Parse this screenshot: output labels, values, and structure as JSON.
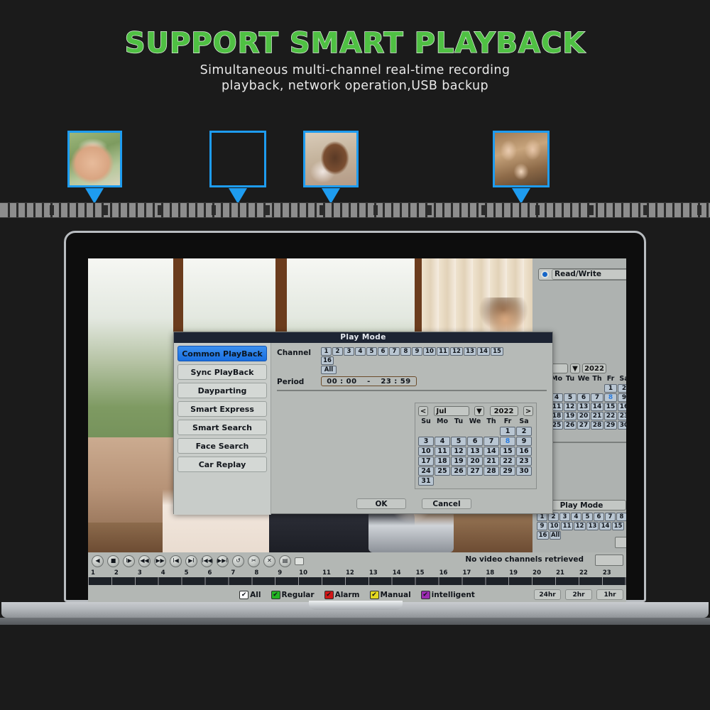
{
  "header": {
    "title": "SUPPORT SMART PLAYBACK",
    "subtitle_line1": "Simultaneous multi-channel real-time recording",
    "subtitle_line2": "playback, network operation,USB backup",
    "title_color": "#4fc043",
    "thumb_border_color": "#1e9cf0"
  },
  "thumbnails": [
    {
      "name": "thumb-elderly-man"
    },
    {
      "name": "thumb-child-balloon"
    },
    {
      "name": "thumb-girl-profile"
    },
    {
      "name": "thumb-family-group"
    }
  ],
  "dialog": {
    "title": "Play Mode",
    "modes": [
      "Common PlayBack",
      "Sync PlayBack",
      "Dayparting",
      "Smart Express",
      "Smart Search",
      "Face Search",
      "Car Replay"
    ],
    "active_mode": "Common PlayBack",
    "channel_label": "Channel",
    "channels": [
      "1",
      "2",
      "3",
      "4",
      "5",
      "6",
      "7",
      "8",
      "9",
      "10",
      "11",
      "12",
      "13",
      "14",
      "15",
      "16"
    ],
    "channel_all": "All",
    "selected_channels": [
      "2",
      "14"
    ],
    "period_label": "Period",
    "period_start": "00 : 00",
    "period_dash": "-",
    "period_end": "23 : 59",
    "ok_label": "OK",
    "cancel_label": "Cancel"
  },
  "calendar": {
    "prev_label": "<",
    "next_label": ">",
    "month": "Jul",
    "year": "2022",
    "dropdown_icon": "chevron-down-icon",
    "dow": [
      "Su",
      "Mo",
      "Tu",
      "We",
      "Th",
      "Fr",
      "Sa"
    ],
    "lead_blanks": 5,
    "days": [
      1,
      2,
      3,
      4,
      5,
      6,
      7,
      8,
      9,
      10,
      11,
      12,
      13,
      14,
      15,
      16,
      17,
      18,
      19,
      20,
      21,
      22,
      23,
      24,
      25,
      26,
      27,
      28,
      29,
      30,
      31
    ],
    "selected_day": 8
  },
  "right_panel": {
    "readwrite_label": "Read/Write",
    "radio_icon": "radio-selected-icon",
    "play_mode_title": "Play Mode",
    "channels": [
      "1",
      "2",
      "3",
      "4",
      "5",
      "6",
      "7",
      "8",
      "9",
      "10",
      "11",
      "12",
      "13",
      "14",
      "15",
      "16"
    ],
    "channel_all": "All"
  },
  "controls": {
    "buttons": [
      {
        "name": "play-reverse-button",
        "glyph": "◀"
      },
      {
        "name": "stop-button",
        "glyph": "■"
      },
      {
        "name": "slow-forward-button",
        "glyph": "I▶"
      },
      {
        "name": "rewind-button",
        "glyph": "◀◀"
      },
      {
        "name": "fast-forward-button",
        "glyph": "▶▶"
      },
      {
        "name": "previous-frame-button",
        "glyph": "I◀"
      },
      {
        "name": "next-frame-button",
        "glyph": "▶I"
      },
      {
        "name": "previous-file-button",
        "glyph": "I◀◀"
      },
      {
        "name": "next-file-button",
        "glyph": "▶▶I"
      },
      {
        "name": "loop-button",
        "glyph": "↺"
      },
      {
        "name": "clip-button",
        "glyph": "✂"
      },
      {
        "name": "close-clip-button",
        "glyph": "✕"
      },
      {
        "name": "save-button",
        "glyph": "▤"
      }
    ],
    "fullscreen_toggle": "fullscreen-icon",
    "status_text": "No video channels retrieved"
  },
  "timeline": {
    "hours": [
      "1",
      "2",
      "3",
      "4",
      "5",
      "6",
      "7",
      "8",
      "9",
      "10",
      "11",
      "12",
      "13",
      "14",
      "15",
      "16",
      "17",
      "18",
      "19",
      "20",
      "21",
      "22",
      "23"
    ]
  },
  "legend": [
    {
      "label": "All",
      "color": "#ffffff",
      "checked": true
    },
    {
      "label": "Regular",
      "color": "#22b422",
      "checked": true
    },
    {
      "label": "Alarm",
      "color": "#d11717",
      "checked": true
    },
    {
      "label": "Manual",
      "color": "#e3d720",
      "checked": true
    },
    {
      "label": "intelligent",
      "color": "#9a2bb0",
      "checked": true
    }
  ],
  "zoom_buttons": [
    "24hr",
    "2hr",
    "1hr"
  ]
}
